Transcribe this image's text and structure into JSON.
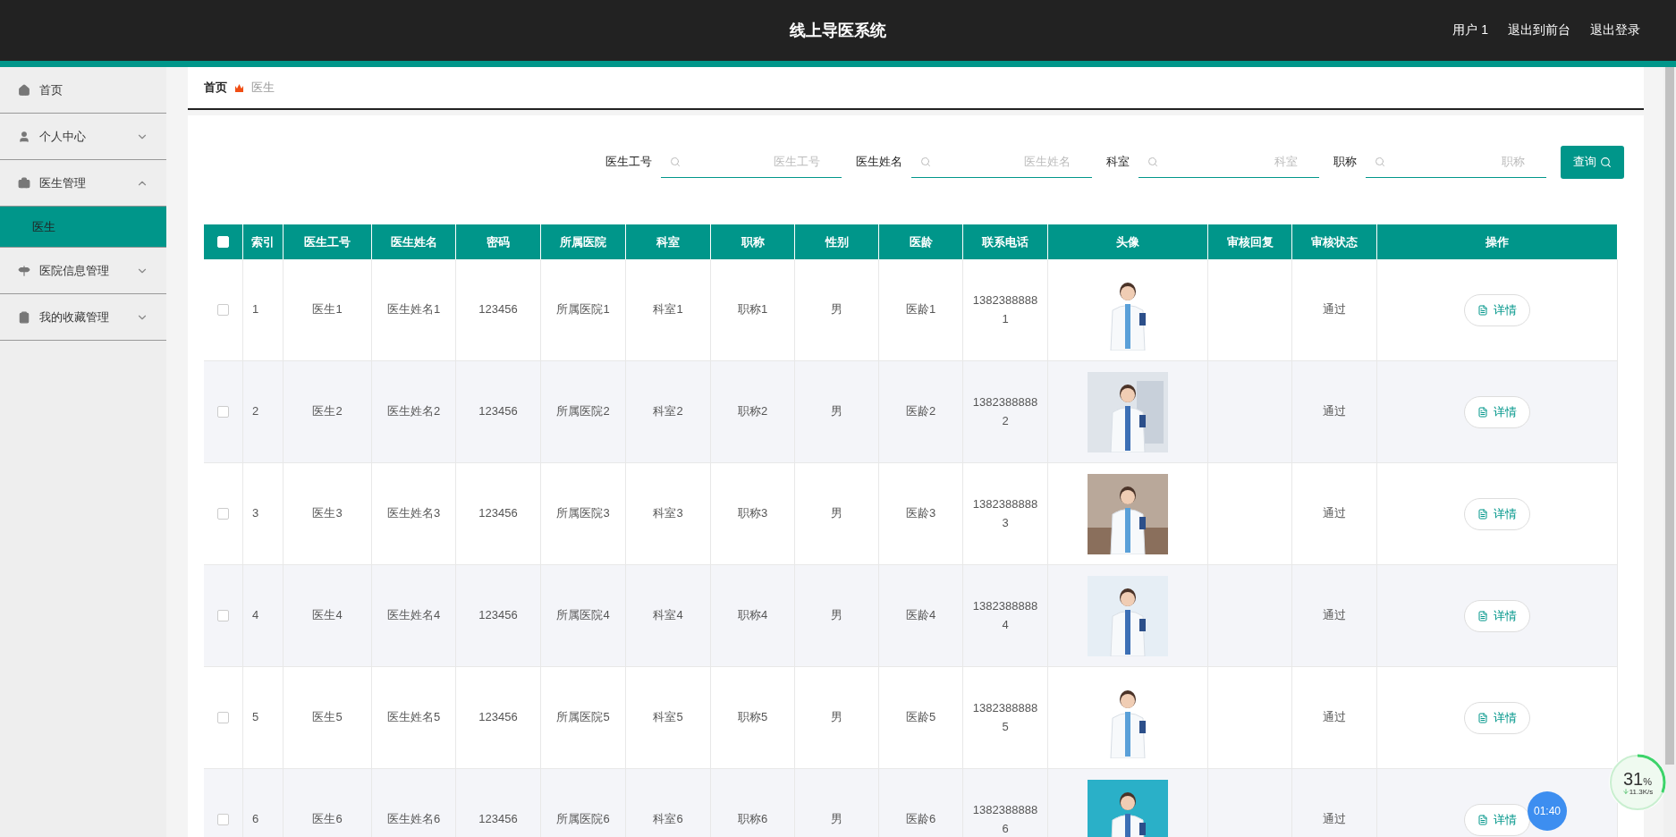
{
  "header": {
    "title": "线上导医系统",
    "links": [
      "用户 1",
      "退出到前台",
      "退出登录"
    ]
  },
  "sidebar": {
    "items": [
      {
        "label": "首页"
      },
      {
        "label": "个人中心",
        "expanded": false
      },
      {
        "label": "医生管理",
        "expanded": true,
        "children": [
          {
            "label": "医生",
            "selected": true
          }
        ]
      },
      {
        "label": "医院信息管理",
        "expanded": false
      },
      {
        "label": "我的收藏管理",
        "expanded": false
      }
    ]
  },
  "breadcrumb": [
    "首页",
    "医生"
  ],
  "search": {
    "fields": [
      {
        "label": "医生工号",
        "placeholder": "医生工号"
      },
      {
        "label": "医生姓名",
        "placeholder": "医生姓名"
      },
      {
        "label": "科室",
        "placeholder": "科室"
      },
      {
        "label": "职称",
        "placeholder": "职称"
      }
    ],
    "button": "查询"
  },
  "table": {
    "select_all": {
      "checked": false
    },
    "columns": [
      "索引",
      "医生工号",
      "医生姓名",
      "密码",
      "所属医院",
      "科室",
      "职称",
      "性别",
      "医龄",
      "联系电话",
      "头像",
      "审核回复",
      "审核状态",
      "操作"
    ],
    "rows": [
      {
        "checked": false,
        "cells": [
          "1",
          "医生1",
          "医生姓名1",
          "123456",
          "所属医院1",
          "科室1",
          "职称1",
          "男",
          "医龄1",
          "13823888881"
        ],
        "status": "通过",
        "action": "详情"
      },
      {
        "checked": false,
        "cells": [
          "2",
          "医生2",
          "医生姓名2",
          "123456",
          "所属医院2",
          "科室2",
          "职称2",
          "男",
          "医龄2",
          "13823888882"
        ],
        "status": "通过",
        "action": "详情"
      },
      {
        "checked": false,
        "cells": [
          "3",
          "医生3",
          "医生姓名3",
          "123456",
          "所属医院3",
          "科室3",
          "职称3",
          "男",
          "医龄3",
          "13823888883"
        ],
        "status": "通过",
        "action": "详情"
      },
      {
        "checked": false,
        "cells": [
          "4",
          "医生4",
          "医生姓名4",
          "123456",
          "所属医院4",
          "科室4",
          "职称4",
          "男",
          "医龄4",
          "13823888884"
        ],
        "status": "通过",
        "action": "详情"
      },
      {
        "checked": false,
        "cells": [
          "5",
          "医生5",
          "医生姓名5",
          "123456",
          "所属医院5",
          "科室5",
          "职称5",
          "男",
          "医龄5",
          "13823888885"
        ],
        "status": "通过",
        "action": "详情"
      },
      {
        "checked": false,
        "cells": [
          "6",
          "医生6",
          "医生姓名6",
          "123456",
          "所属医院6",
          "科室6",
          "职称6",
          "男",
          "医龄6",
          "13823888886"
        ],
        "status": "通过",
        "action": "详情"
      }
    ]
  },
  "net_widget": {
    "percent": "31",
    "unit": "%",
    "speed": "11.3K/s",
    "level": 0.31
  },
  "timer": "01:40"
}
